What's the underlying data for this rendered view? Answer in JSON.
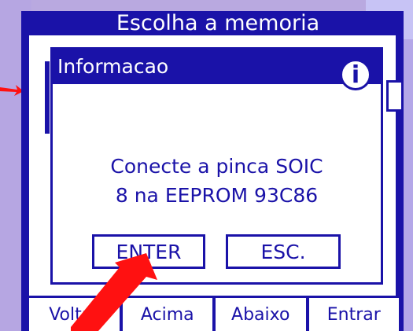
{
  "screen": {
    "title": "Escolha a memoria"
  },
  "softkeys": [
    "Voltar",
    "Acima",
    "Abaixo",
    "Entrar"
  ],
  "dialog": {
    "title": "Informacao",
    "icon": "info-icon",
    "message_line1": "Conecte a pinca SOIC",
    "message_line2": "8 na EEPROM 93C86",
    "enter_label": "ENTER",
    "esc_label": "ESC."
  },
  "colors": {
    "accent": "#1a12a8",
    "arrow": "#ff1111",
    "background": "#b9a9e0"
  }
}
